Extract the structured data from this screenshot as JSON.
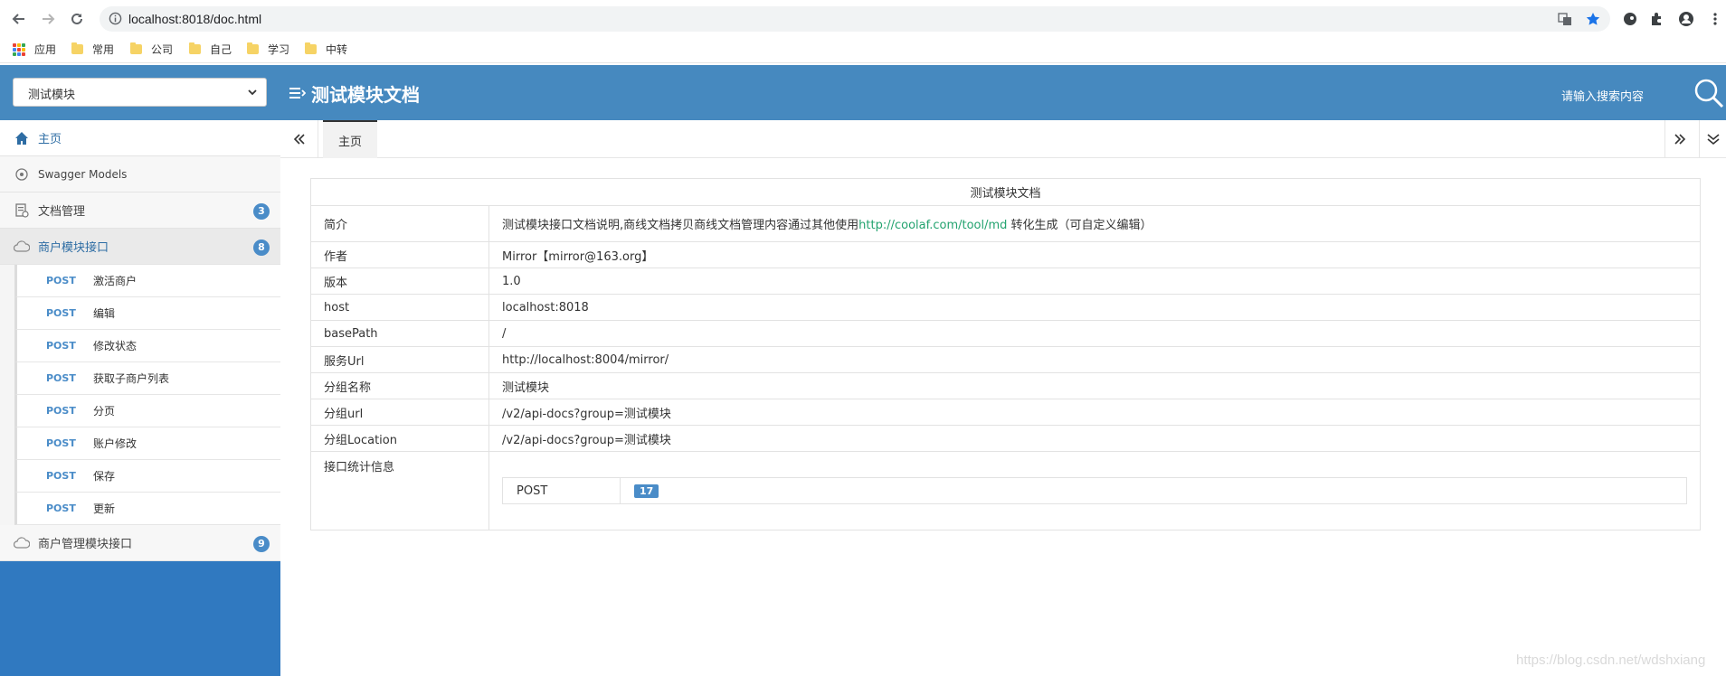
{
  "browser": {
    "url": "localhost:8018/doc.html",
    "bookmarks": [
      {
        "label": "应用",
        "icon": "apps-grid-icon"
      },
      {
        "label": "常用",
        "icon": "folder-icon"
      },
      {
        "label": "公司",
        "icon": "folder-icon"
      },
      {
        "label": "自己",
        "icon": "folder-icon"
      },
      {
        "label": "学习",
        "icon": "folder-icon"
      },
      {
        "label": "中转",
        "icon": "folder-icon"
      }
    ]
  },
  "header": {
    "group_select": "测试模块",
    "title": "测试模块文档",
    "search_placeholder": "请输入搜索内容"
  },
  "sidebar": {
    "items": [
      {
        "label": "主页",
        "icon": "home-icon"
      },
      {
        "label": "Swagger Models",
        "icon": "models-icon"
      },
      {
        "label": "文档管理",
        "icon": "doc-manage-icon",
        "badge": "3"
      },
      {
        "label": "商户模块接口",
        "icon": "cloud-icon",
        "badge": "8"
      },
      {
        "label": "商户管理模块接口",
        "icon": "cloud-icon",
        "badge": "9"
      }
    ],
    "sub_items": [
      {
        "method": "POST",
        "label": "激活商户"
      },
      {
        "method": "POST",
        "label": "编辑"
      },
      {
        "method": "POST",
        "label": "修改状态"
      },
      {
        "method": "POST",
        "label": "获取子商户列表"
      },
      {
        "method": "POST",
        "label": "分页"
      },
      {
        "method": "POST",
        "label": "账户修改"
      },
      {
        "method": "POST",
        "label": "保存"
      },
      {
        "method": "POST",
        "label": "更新"
      }
    ]
  },
  "tabs": {
    "home": "主页"
  },
  "doc": {
    "title": "测试模块文档",
    "rows": [
      {
        "key": "简介",
        "value_prefix": "测试模块接口文档说明,商线文档拷贝商线文档管理内容通过其他使用",
        "link": "http://coolaf.com/tool/md",
        "value_suffix": " 转化生成（可自定义编辑）"
      },
      {
        "key": "作者",
        "value": "Mirror【mirror@163.org】"
      },
      {
        "key": "版本",
        "value": "1.0"
      },
      {
        "key": "host",
        "value": "localhost:8018"
      },
      {
        "key": "basePath",
        "value": "/"
      },
      {
        "key": "服务Url",
        "value": "http://localhost:8004/mirror/"
      },
      {
        "key": "分组名称",
        "value": "测试模块"
      },
      {
        "key": "分组url",
        "value": "/v2/api-docs?group=测试模块"
      },
      {
        "key": "分组Location",
        "value": "/v2/api-docs?group=测试模块"
      },
      {
        "key": "接口统计信息"
      }
    ],
    "stats": {
      "method": "POST",
      "count": "17"
    }
  },
  "watermark": "https://blog.csdn.net/wdshxiang",
  "colors": {
    "header_bg": "#4689bf",
    "sidebar_bg": "#3079c0",
    "badge": "#4a8cc8",
    "link": "#23a36f"
  }
}
